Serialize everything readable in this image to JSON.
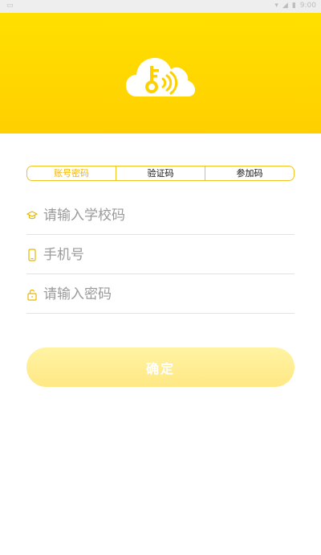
{
  "status_bar": {
    "left_icon": "notification-icon",
    "right_icons": [
      "wifi-icon",
      "signal-icon",
      "battery-icon"
    ],
    "time": "9:00"
  },
  "header": {
    "logo_icon": "cloud-key-wireless-icon",
    "gradient_top": "#ffe000",
    "gradient_bottom": "#ffcf00"
  },
  "tabs": [
    {
      "label": "账号密码",
      "active": true
    },
    {
      "label": "验证码",
      "active": false
    },
    {
      "label": "参加码",
      "active": false
    }
  ],
  "fields": {
    "school_code": {
      "placeholder": "请输入学校码",
      "icon": "graduation-cap-icon"
    },
    "phone": {
      "placeholder": "手机号",
      "icon": "phone-icon"
    },
    "password": {
      "placeholder": "请输入密码",
      "icon": "lock-icon"
    }
  },
  "confirm_button": {
    "label": "确定"
  },
  "colors": {
    "accent": "#f3c321",
    "button_bg": "#fff0a0"
  }
}
